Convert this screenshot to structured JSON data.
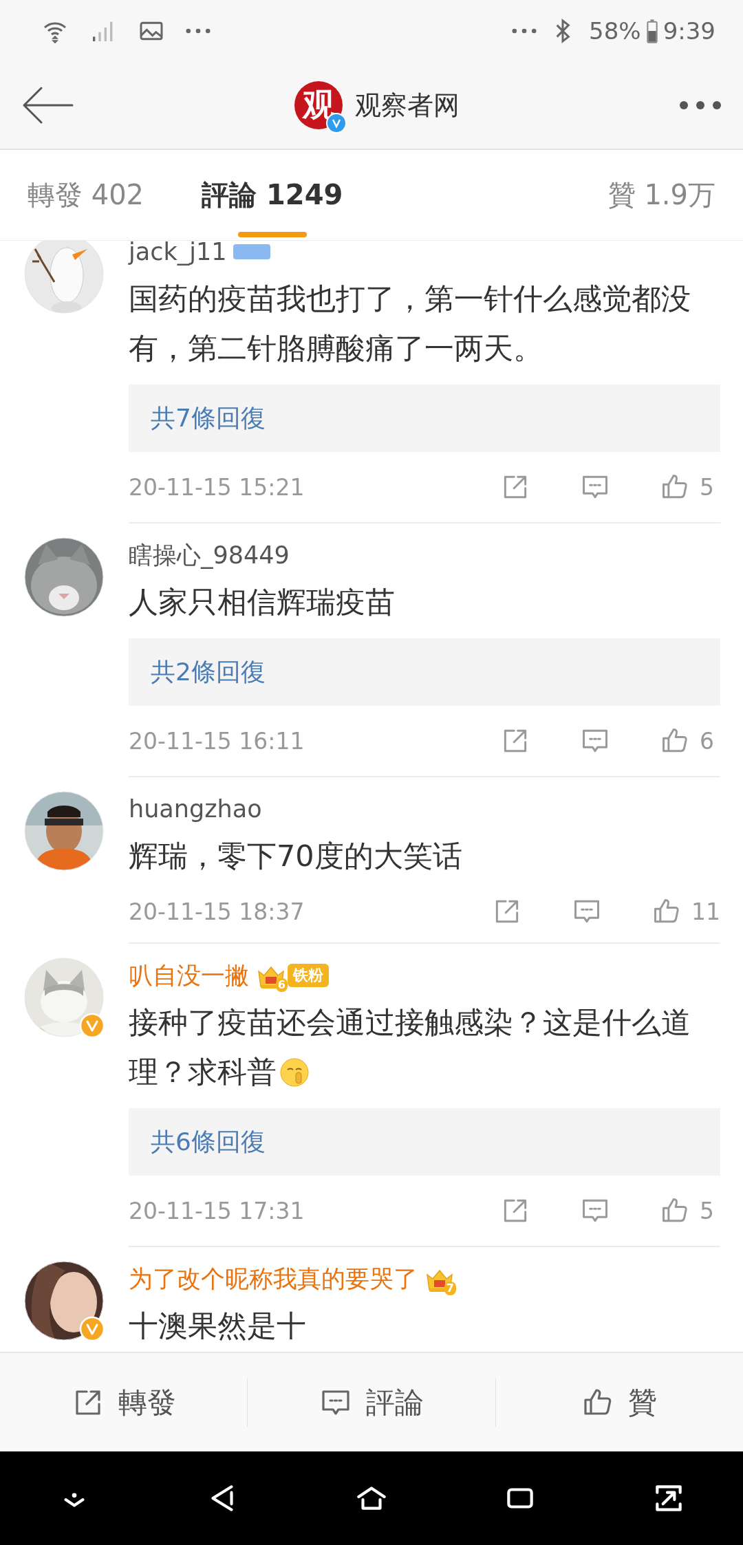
{
  "status_bar": {
    "battery": "58%",
    "time": "9:39"
  },
  "header": {
    "logo_text": "观",
    "title": "观察者网",
    "verified": true
  },
  "tabs": [
    {
      "label": "轉發 402",
      "selected": false
    },
    {
      "label": "評論 1249",
      "selected": true
    },
    {
      "label": "贊 1.9万",
      "selected": false
    }
  ],
  "comments": [
    {
      "name": "jack_j11",
      "member": false,
      "verified": false,
      "badge": {
        "kind": "tag"
      },
      "text": "国药的疫苗我也打了，第一针什么感觉都没有，第二针胳膊酸痛了一两天。",
      "emoji": false,
      "replies": "共7條回復",
      "time": "20-11-15 15:21",
      "likes": "5"
    },
    {
      "name": "瞎操心_98449",
      "member": false,
      "verified": false,
      "text": "人家只相信辉瑞疫苗",
      "emoji": false,
      "replies": "共2條回復",
      "time": "20-11-15 16:11",
      "likes": "6"
    },
    {
      "name": "huangzhao",
      "member": false,
      "verified": false,
      "text": "辉瑞，零下70度的大笑话",
      "emoji": false,
      "time": "20-11-15 18:37",
      "likes": "11"
    },
    {
      "name": "叭自没一撇",
      "member": true,
      "verified": true,
      "badge": {
        "kind": "fan",
        "level": "6",
        "label": "铁粉"
      },
      "text": "接种了疫苗还会通过接触感染？这是什么道理？求科普",
      "emoji": true,
      "replies": "共6條回復",
      "time": "20-11-15 17:31",
      "likes": "5"
    },
    {
      "name": "为了改个昵称我真的要哭了",
      "member": true,
      "verified": true,
      "badge": {
        "kind": "crown",
        "level": "7"
      },
      "text": "十澳果然是十",
      "emoji": false
    }
  ],
  "actions": [
    {
      "kind": "share",
      "label": "轉發"
    },
    {
      "kind": "comment",
      "label": "評論"
    },
    {
      "kind": "like",
      "label": "贊"
    }
  ]
}
